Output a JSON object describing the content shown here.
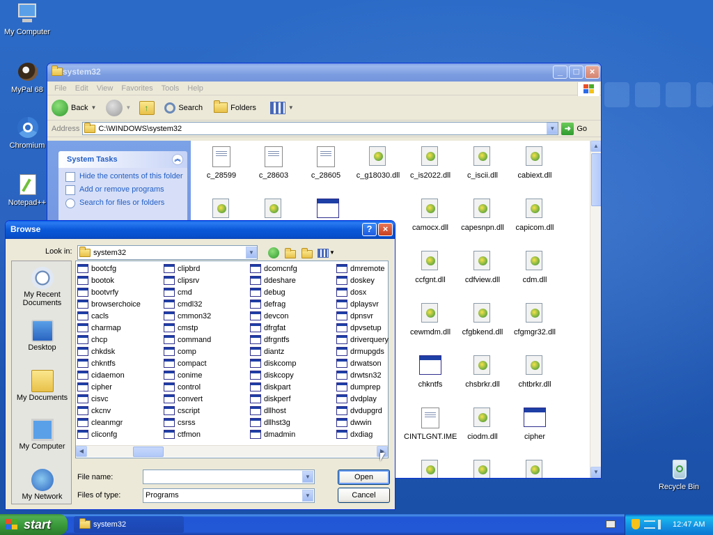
{
  "desktop": {
    "icons": [
      {
        "label": "My Computer",
        "icon": "my-computer-icon"
      },
      {
        "label": "MyPal 68",
        "icon": "mypal-icon"
      },
      {
        "label": "Chromium",
        "icon": "chromium-icon"
      },
      {
        "label": "Notepad++",
        "icon": "notepadpp-icon"
      },
      {
        "label": "Recycle Bin",
        "icon": "recycle-bin-icon"
      }
    ]
  },
  "explorer": {
    "title": "system32",
    "menu": [
      "File",
      "Edit",
      "View",
      "Favorites",
      "Tools",
      "Help"
    ],
    "toolbar": {
      "back": "Back",
      "search": "Search",
      "folders": "Folders"
    },
    "address": {
      "label": "Address",
      "value": "C:\\WINDOWS\\system32",
      "go": "Go"
    },
    "system_tasks": {
      "title": "System Tasks",
      "items": [
        "Hide the contents of this folder",
        "Add or remove programs",
        "Search for files or folders"
      ]
    },
    "files": [
      {
        "name": "c_28599",
        "type": "doc"
      },
      {
        "name": "c_28603",
        "type": "doc"
      },
      {
        "name": "c_28605",
        "type": "doc"
      },
      {
        "name": "c_g18030.dll",
        "type": "dll"
      },
      {
        "name": "c_is2022.dll",
        "type": "dll"
      },
      {
        "name": "c_iscii.dll",
        "type": "dll"
      },
      {
        "name": "cabiext.dll",
        "type": "dll"
      },
      {
        "name": "camocx.dll",
        "type": "dll"
      },
      {
        "name": "capesnpn.dll",
        "type": "dll"
      },
      {
        "name": "capicom.dll",
        "type": "dll"
      },
      {
        "name": "ccfgnt.dll",
        "type": "dll"
      },
      {
        "name": "cdfview.dll",
        "type": "dll"
      },
      {
        "name": "cdm.dll",
        "type": "dll"
      },
      {
        "name": "cewmdm.dll",
        "type": "dll"
      },
      {
        "name": "cfgbkend.dll",
        "type": "dll"
      },
      {
        "name": "cfgmgr32.dll",
        "type": "dll"
      },
      {
        "name": "chkntfs",
        "type": "exe"
      },
      {
        "name": "chsbrkr.dll",
        "type": "dll"
      },
      {
        "name": "chtbrkr.dll",
        "type": "dll"
      },
      {
        "name": "CINTLGNT.IME",
        "type": "doc"
      },
      {
        "name": "ciodm.dll",
        "type": "dll"
      },
      {
        "name": "cipher",
        "type": "exe"
      }
    ]
  },
  "browse": {
    "title": "Browse",
    "look_in_label": "Look in:",
    "look_in_value": "system32",
    "places": [
      "My Recent Documents",
      "Desktop",
      "My Documents",
      "My Computer",
      "My Network"
    ],
    "columns": [
      [
        "bootcfg",
        "bootok",
        "bootvrfy",
        "browserchoice",
        "cacls",
        "charmap",
        "chcp",
        "chkdsk",
        "chkntfs",
        "cidaemon",
        "cipher",
        "cisvc",
        "ckcnv",
        "cleanmgr",
        "cliconfg"
      ],
      [
        "clipbrd",
        "clipsrv",
        "cmd",
        "cmdl32",
        "cmmon32",
        "cmstp",
        "command",
        "comp",
        "compact",
        "conime",
        "control",
        "convert",
        "cscript",
        "csrss",
        "ctfmon"
      ],
      [
        "dcomcnfg",
        "ddeshare",
        "debug",
        "defrag",
        "devcon",
        "dfrgfat",
        "dfrgntfs",
        "diantz",
        "diskcomp",
        "diskcopy",
        "diskpart",
        "diskperf",
        "dllhost",
        "dllhst3g",
        "dmadmin"
      ],
      [
        "dmremote",
        "doskey",
        "dosx",
        "dplaysvr",
        "dpnsvr",
        "dpvsetup",
        "driverquery",
        "drmupgds",
        "drwatson",
        "drwtsn32",
        "dumprep",
        "dvdplay",
        "dvdupgrd",
        "dwwin",
        "dxdiag"
      ]
    ],
    "file_name_label": "File name:",
    "file_name_value": "",
    "file_type_label": "Files of type:",
    "file_type_value": "Programs",
    "open": "Open",
    "cancel": "Cancel"
  },
  "taskbar": {
    "start": "start",
    "window_button": "system32",
    "clock": "12:47 AM"
  }
}
